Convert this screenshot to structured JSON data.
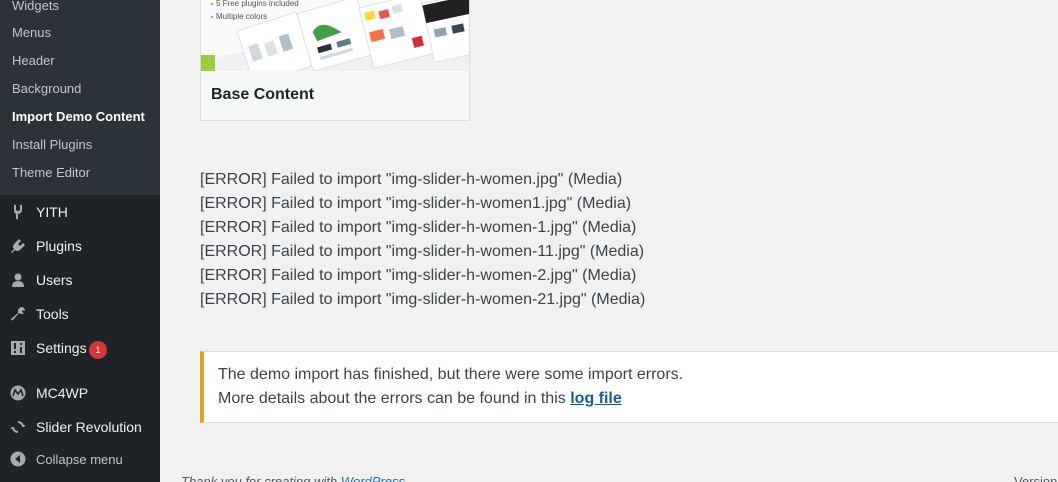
{
  "sidebar": {
    "submenu": [
      {
        "label": "Widgets"
      },
      {
        "label": "Menus"
      },
      {
        "label": "Header"
      },
      {
        "label": "Background"
      },
      {
        "label": "Import Demo Content"
      },
      {
        "label": "Install Plugins"
      },
      {
        "label": "Theme Editor"
      }
    ],
    "menu": [
      {
        "label": "YITH",
        "icon": "yith-icon"
      },
      {
        "label": "Plugins",
        "icon": "plugins-icon"
      },
      {
        "label": "Users",
        "icon": "users-icon"
      },
      {
        "label": "Tools",
        "icon": "tools-icon"
      },
      {
        "label": "Settings",
        "icon": "settings-icon",
        "badge": "1"
      },
      {
        "label": "MC4WP",
        "icon": "mc4wp-icon"
      },
      {
        "label": "Slider Revolution",
        "icon": "slider-revolution-icon"
      },
      {
        "label": "Collapse menu",
        "icon": "collapse-icon"
      }
    ]
  },
  "demo_card": {
    "thumb_lines": [
      "5 Free plugins included",
      "Multiple colors"
    ],
    "title": "Base Content"
  },
  "import_log": [
    "[ERROR] Failed to import \"img-slider-h-women.jpg\" (Media)",
    "[ERROR] Failed to import \"img-slider-h-women1.jpg\" (Media)",
    "[ERROR] Failed to import \"img-slider-h-women-1.jpg\" (Media)",
    "[ERROR] Failed to import \"img-slider-h-women-11.jpg\" (Media)",
    "[ERROR] Failed to import \"img-slider-h-women-2.jpg\" (Media)",
    "[ERROR] Failed to import \"img-slider-h-women-21.jpg\" (Media)"
  ],
  "notice": {
    "line1": "The demo import has finished, but there were some import errors.",
    "line2": "More details about the errors can be found in this",
    "link": "log file",
    "accent": "#dba617"
  },
  "footer": {
    "thanks": "Thank you for creating with",
    "link": "WordPress",
    "version": "Version"
  },
  "colors": {
    "sidebar_bg": "#1d2327",
    "submenu_bg": "#2c3338",
    "badge": "#d63638",
    "link": "#2271b1"
  }
}
